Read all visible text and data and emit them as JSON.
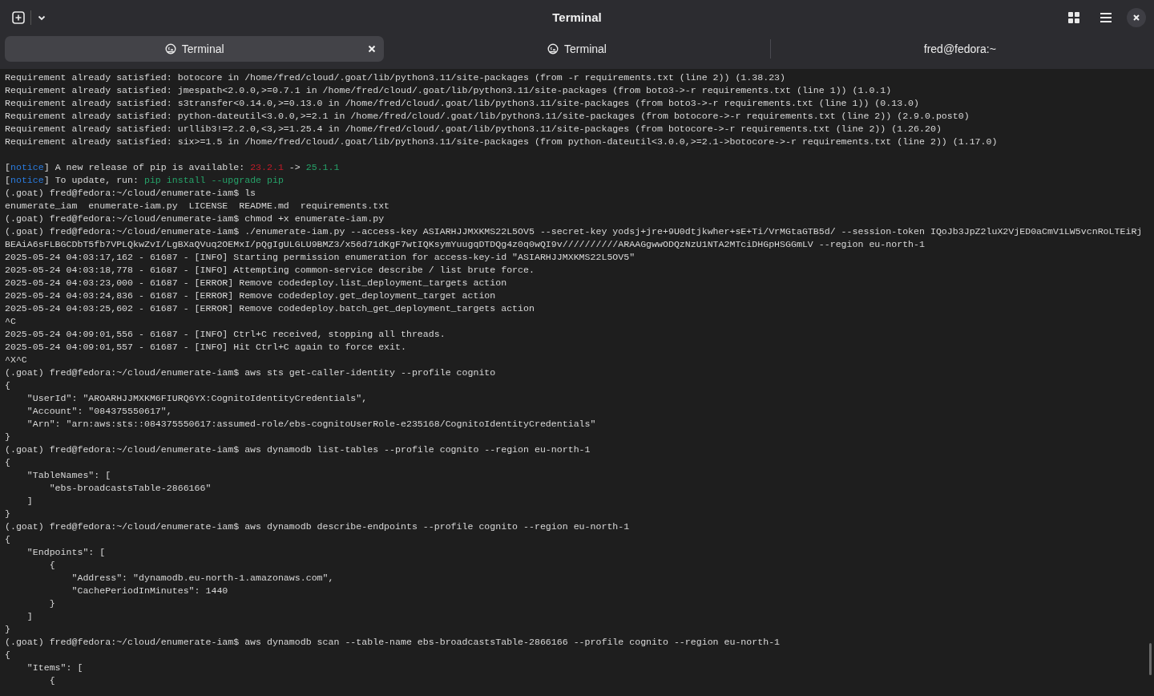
{
  "window": {
    "title": "Terminal"
  },
  "tabs": [
    {
      "label": "Terminal",
      "selected": true,
      "kind": "terminal"
    },
    {
      "label": "Terminal",
      "selected": false,
      "kind": "terminal"
    },
    {
      "label": "fred@fedora:~",
      "selected": false,
      "kind": "plain"
    }
  ],
  "lines": [
    {
      "kind": "plain",
      "text": "Requirement already satisfied: botocore in /home/fred/cloud/.goat/lib/python3.11/site-packages (from -r requirements.txt (line 2)) (1.38.23)"
    },
    {
      "kind": "plain",
      "text": "Requirement already satisfied: jmespath<2.0.0,>=0.7.1 in /home/fred/cloud/.goat/lib/python3.11/site-packages (from boto3->-r requirements.txt (line 1)) (1.0.1)"
    },
    {
      "kind": "plain",
      "text": "Requirement already satisfied: s3transfer<0.14.0,>=0.13.0 in /home/fred/cloud/.goat/lib/python3.11/site-packages (from boto3->-r requirements.txt (line 1)) (0.13.0)"
    },
    {
      "kind": "plain",
      "text": "Requirement already satisfied: python-dateutil<3.0.0,>=2.1 in /home/fred/cloud/.goat/lib/python3.11/site-packages (from botocore->-r requirements.txt (line 2)) (2.9.0.post0)"
    },
    {
      "kind": "plain",
      "text": "Requirement already satisfied: urllib3!=2.2.0,<3,>=1.25.4 in /home/fred/cloud/.goat/lib/python3.11/site-packages (from botocore->-r requirements.txt (line 2)) (1.26.20)"
    },
    {
      "kind": "plain",
      "text": "Requirement already satisfied: six>=1.5 in /home/fred/cloud/.goat/lib/python3.11/site-packages (from python-dateutil<3.0.0,>=2.1->botocore->-r requirements.txt (line 2)) (1.17.0)"
    },
    {
      "kind": "blank"
    },
    {
      "kind": "colored",
      "segments": [
        {
          "text": "["
        },
        {
          "text": "notice",
          "color": "#2a7bde"
        },
        {
          "text": "] A new release of pip is available: "
        },
        {
          "text": "23.2.1",
          "color": "#c01c28"
        },
        {
          "text": " -> "
        },
        {
          "text": "25.1.1",
          "color": "#26a269"
        }
      ]
    },
    {
      "kind": "colored",
      "segments": [
        {
          "text": "["
        },
        {
          "text": "notice",
          "color": "#2a7bde"
        },
        {
          "text": "] To update, run: "
        },
        {
          "text": "pip install --upgrade pip",
          "color": "#26a269"
        }
      ]
    },
    {
      "kind": "plain",
      "text": "(.goat) fred@fedora:~/cloud/enumerate-iam$ ls"
    },
    {
      "kind": "plain",
      "text": "enumerate_iam  enumerate-iam.py  LICENSE  README.md  requirements.txt"
    },
    {
      "kind": "plain",
      "text": "(.goat) fred@fedora:~/cloud/enumerate-iam$ chmod +x enumerate-iam.py"
    },
    {
      "kind": "plain",
      "text": "(.goat) fred@fedora:~/cloud/enumerate-iam$ ./enumerate-iam.py --access-key ASIARHJJMXKMS22L5OV5 --secret-key yodsj+jre+9U0dtjkwher+sE+Ti/VrMGtaGTB5d/ --session-token IQoJb3JpZ2luX2VjED0aCmV1LW5vcnRoLTEiRj"
    },
    {
      "kind": "plain",
      "text": "BEAiA6sFLBGCDbT5fb7VPLQkwZvI/LgBXaQVuq2OEMxI/pQgIgULGLU9BMZ3/x56d71dKgF7wtIQKsymYuugqDTDQg4z0q0wQI9v//////////ARAAGgwwODQzNzU1NTA2MTciDHGpHSGGmLV --region eu-north-1"
    },
    {
      "kind": "plain",
      "text": "2025-05-24 04:03:17,162 - 61687 - [INFO] Starting permission enumeration for access-key-id \"ASIARHJJMXKMS22L5OV5\""
    },
    {
      "kind": "plain",
      "text": "2025-05-24 04:03:18,778 - 61687 - [INFO] Attempting common-service describe / list brute force."
    },
    {
      "kind": "plain",
      "text": "2025-05-24 04:03:23,000 - 61687 - [ERROR] Remove codedeploy.list_deployment_targets action"
    },
    {
      "kind": "plain",
      "text": "2025-05-24 04:03:24,836 - 61687 - [ERROR] Remove codedeploy.get_deployment_target action"
    },
    {
      "kind": "plain",
      "text": "2025-05-24 04:03:25,602 - 61687 - [ERROR] Remove codedeploy.batch_get_deployment_targets action"
    },
    {
      "kind": "plain",
      "text": "^C"
    },
    {
      "kind": "plain",
      "text": "2025-05-24 04:09:01,556 - 61687 - [INFO] Ctrl+C received, stopping all threads."
    },
    {
      "kind": "plain",
      "text": "2025-05-24 04:09:01,557 - 61687 - [INFO] Hit Ctrl+C again to force exit."
    },
    {
      "kind": "plain",
      "text": "^X^C"
    },
    {
      "kind": "plain",
      "text": "(.goat) fred@fedora:~/cloud/enumerate-iam$ aws sts get-caller-identity --profile cognito"
    },
    {
      "kind": "plain",
      "text": "{"
    },
    {
      "kind": "plain",
      "text": "    \"UserId\": \"AROARHJJMXKM6FIURQ6YX:CognitoIdentityCredentials\","
    },
    {
      "kind": "plain",
      "text": "    \"Account\": \"084375550617\","
    },
    {
      "kind": "plain",
      "text": "    \"Arn\": \"arn:aws:sts::084375550617:assumed-role/ebs-cognitoUserRole-e235168/CognitoIdentityCredentials\""
    },
    {
      "kind": "plain",
      "text": "}"
    },
    {
      "kind": "plain",
      "text": "(.goat) fred@fedora:~/cloud/enumerate-iam$ aws dynamodb list-tables --profile cognito --region eu-north-1"
    },
    {
      "kind": "plain",
      "text": "{"
    },
    {
      "kind": "plain",
      "text": "    \"TableNames\": ["
    },
    {
      "kind": "plain",
      "text": "        \"ebs-broadcastsTable-2866166\""
    },
    {
      "kind": "plain",
      "text": "    ]"
    },
    {
      "kind": "plain",
      "text": "}"
    },
    {
      "kind": "plain",
      "text": "(.goat) fred@fedora:~/cloud/enumerate-iam$ aws dynamodb describe-endpoints --profile cognito --region eu-north-1"
    },
    {
      "kind": "plain",
      "text": "{"
    },
    {
      "kind": "plain",
      "text": "    \"Endpoints\": ["
    },
    {
      "kind": "plain",
      "text": "        {"
    },
    {
      "kind": "plain",
      "text": "            \"Address\": \"dynamodb.eu-north-1.amazonaws.com\","
    },
    {
      "kind": "plain",
      "text": "            \"CachePeriodInMinutes\": 1440"
    },
    {
      "kind": "plain",
      "text": "        }"
    },
    {
      "kind": "plain",
      "text": "    ]"
    },
    {
      "kind": "plain",
      "text": "}"
    },
    {
      "kind": "plain",
      "text": "(.goat) fred@fedora:~/cloud/enumerate-iam$ aws dynamodb scan --table-name ebs-broadcastsTable-2866166 --profile cognito --region eu-north-1"
    },
    {
      "kind": "plain",
      "text": "{"
    },
    {
      "kind": "plain",
      "text": "    \"Items\": ["
    },
    {
      "kind": "plain",
      "text": "        {"
    }
  ]
}
